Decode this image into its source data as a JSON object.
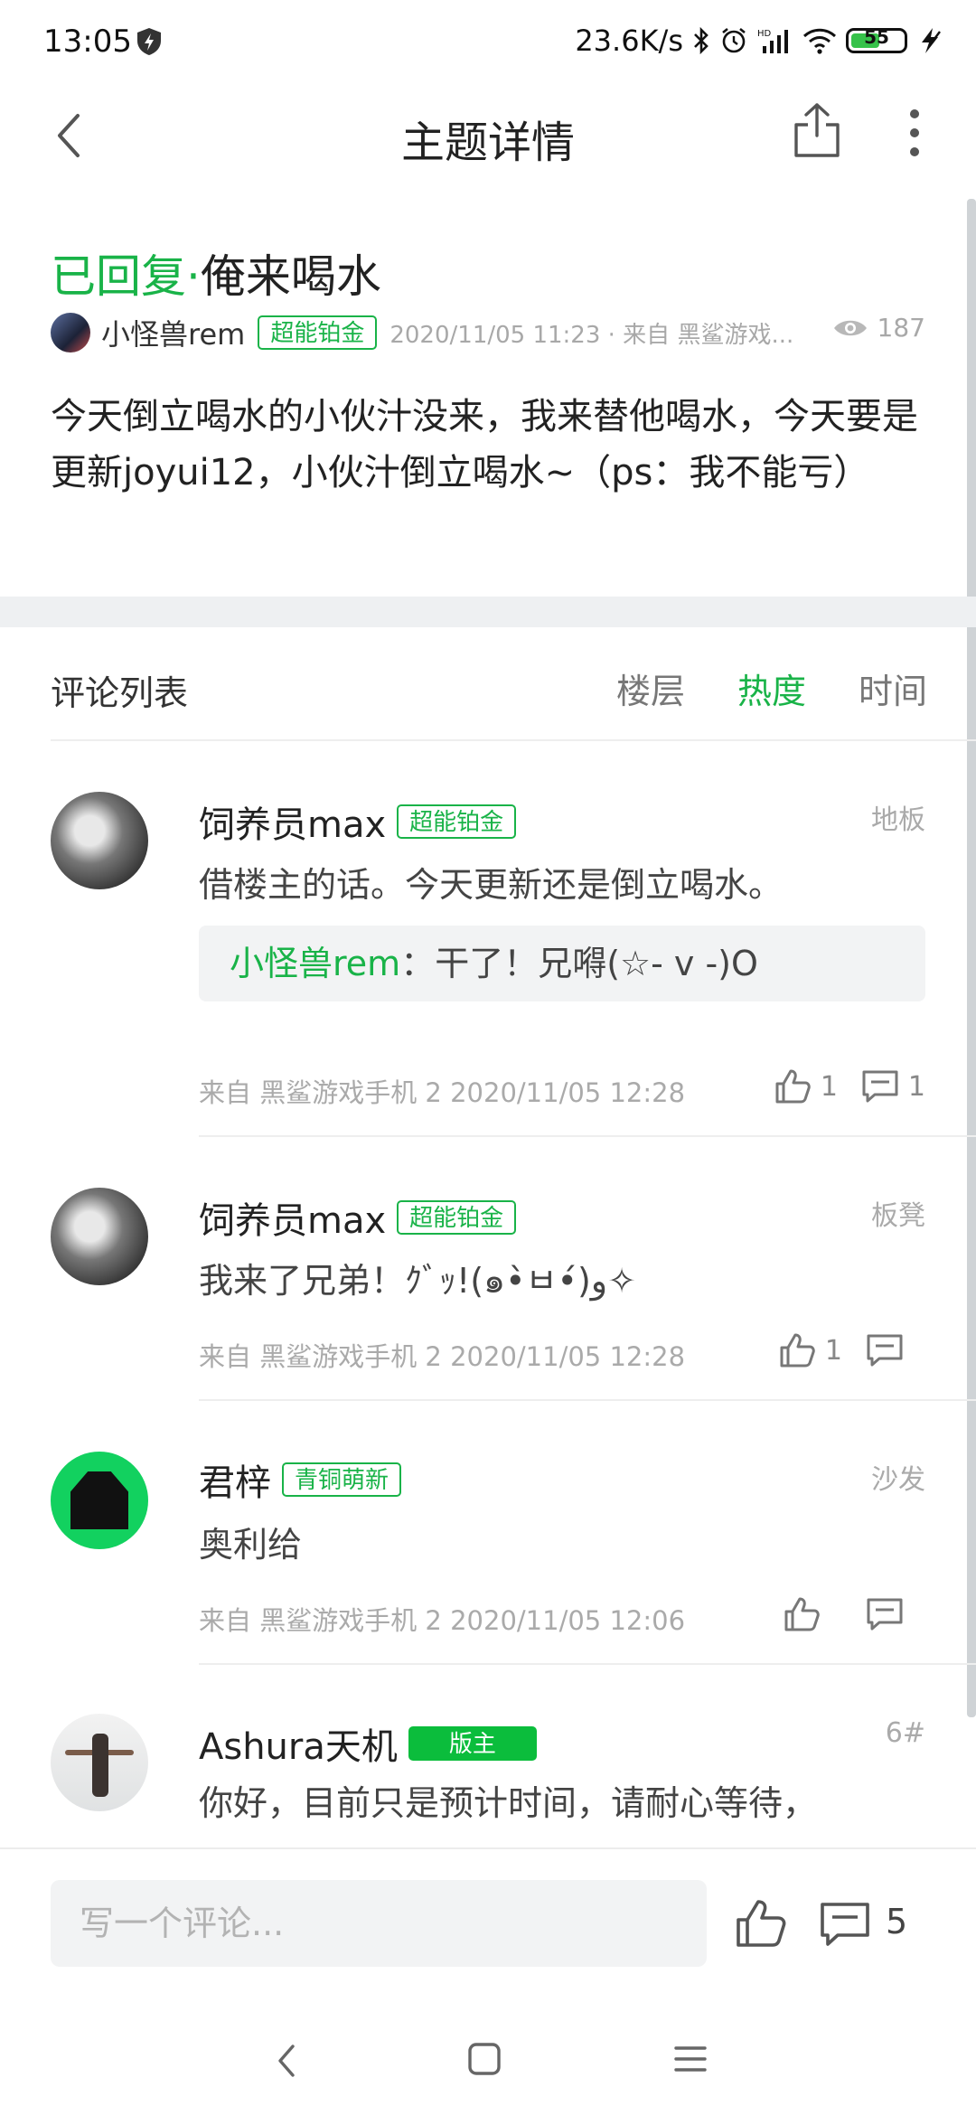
{
  "status_bar": {
    "time": "13:05",
    "network_speed": "23.6K/s",
    "battery": "55"
  },
  "header": {
    "title": "主题详情"
  },
  "post": {
    "status": "已回复",
    "separator": "·",
    "title": "俺来喝水",
    "author": "小怪兽rem",
    "author_badge": "超能铂金",
    "date_source": "2020/11/05 11:23 · 来自 黑鲨游戏...",
    "views": "187",
    "body": "今天倒立喝水的小伙汁没来，我来替他喝水，今天要是更新joyui12，小伙汁倒立喝水~（ps：我不能亏）"
  },
  "comments_header": {
    "label": "评论列表",
    "tabs": [
      {
        "label": "楼层",
        "active": false
      },
      {
        "label": "热度",
        "active": true
      },
      {
        "label": "时间",
        "active": false
      }
    ]
  },
  "comments": [
    {
      "name": "饲养员max",
      "badge": "超能铂金",
      "floor": "地板",
      "text": "借楼主的话。今天更新还是倒立喝水。",
      "reply_name": "小怪兽rem",
      "reply_sep": "：",
      "reply_text": "干了！兄嘚(☆- v -)O",
      "source": "来自 黑鲨游戏手机 2  2020/11/05 12:28",
      "likes": "1",
      "replies": "1"
    },
    {
      "name": "饲养员max",
      "badge": "超能铂金",
      "floor": "板凳",
      "text": "我来了兄弟！ｸﾞｯ!(๑•̀ㅂ•́)و✧",
      "source": "来自 黑鲨游戏手机 2  2020/11/05 12:28",
      "likes": "1",
      "replies": ""
    },
    {
      "name": "君梓",
      "badge": "青铜萌新",
      "floor": "沙发",
      "text": "奥利给",
      "source": "来自 黑鲨游戏手机 2  2020/11/05 12:06",
      "likes": "",
      "replies": ""
    },
    {
      "name": "Ashura天机",
      "badge": "版主",
      "floor": "6#",
      "text": "你好，目前只是预计时间，请耐心等待，"
    }
  ],
  "bottom_bar": {
    "placeholder": "写一个评论...",
    "comment_count": "5"
  },
  "colors": {
    "accent": "#19b348",
    "moderator_badge": "#0bbd3c",
    "divider": "#eef0f2"
  }
}
